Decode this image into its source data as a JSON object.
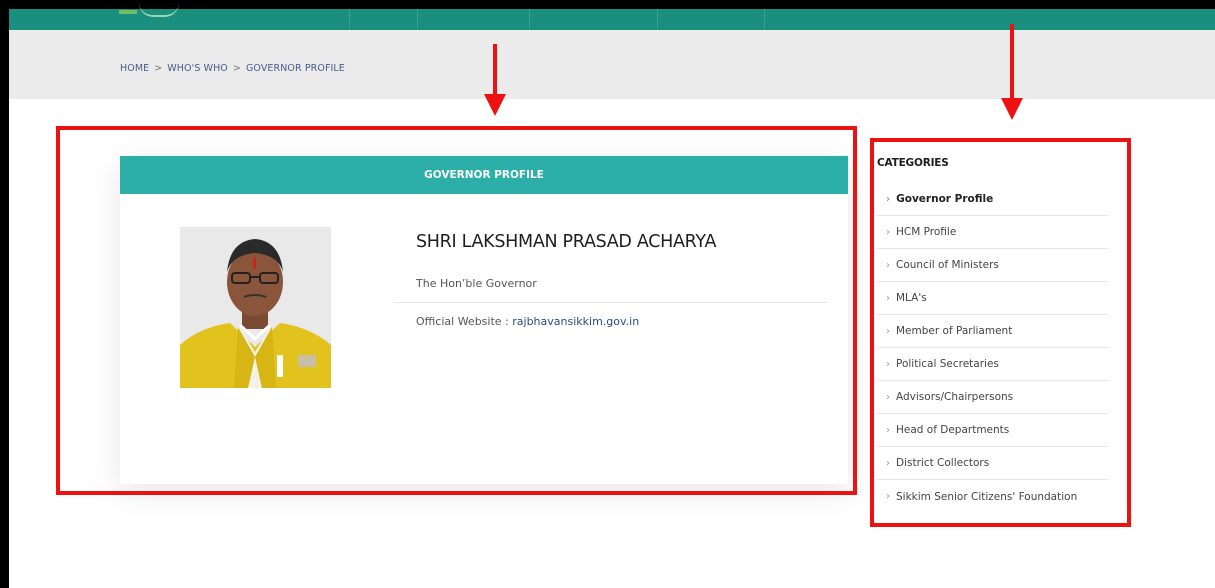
{
  "breadcrumb": {
    "home": "HOME",
    "whos_who": "WHO'S WHO",
    "current": "GOVERNOR PROFILE",
    "separator": ">"
  },
  "profile_card": {
    "header": "GOVERNOR PROFILE",
    "name": "SHRI LAKSHMAN PRASAD ACHARYA",
    "designation": "The Hon’ble Governor",
    "website_label": "Official Website :",
    "website_link": "rajbhavansikkim.gov.in"
  },
  "sidebar": {
    "title": "CATEGORIES",
    "items": [
      {
        "label": "Governor Profile",
        "active": true
      },
      {
        "label": "HCM Profile"
      },
      {
        "label": "Council of Ministers"
      },
      {
        "label": "MLA's"
      },
      {
        "label": "Member of Parliament"
      },
      {
        "label": "Political Secretaries"
      },
      {
        "label": "Advisors/Chairpersons"
      },
      {
        "label": "Head of Departments"
      },
      {
        "label": "District Collectors"
      },
      {
        "label": "Sikkim Senior Citizens' Foundation"
      }
    ]
  },
  "colors": {
    "topbar": "#1b8f7d",
    "card_header": "#2bafa8",
    "annotation": "#ee1111",
    "link": "#2a4a8a"
  }
}
